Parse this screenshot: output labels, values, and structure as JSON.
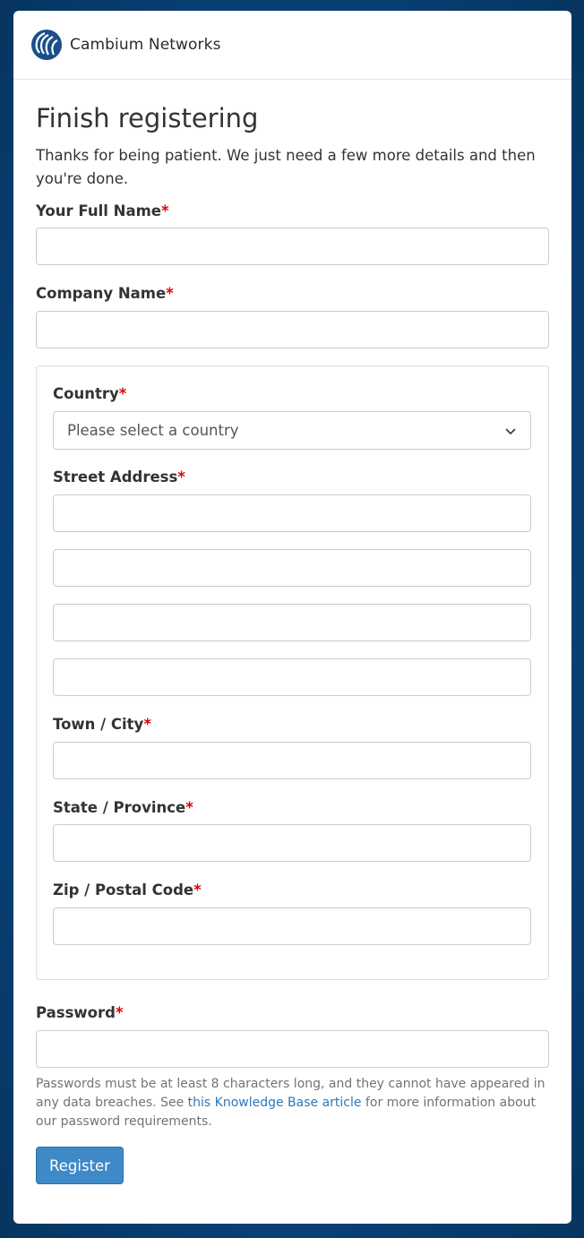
{
  "brand": {
    "name": "Cambium Networks",
    "color": "#1b4f8a"
  },
  "page": {
    "title": "Finish registering",
    "intro": "Thanks for being patient. We just need a few more details and then you're done."
  },
  "form": {
    "required_marker": "*",
    "full_name": {
      "label": "Your Full Name",
      "value": ""
    },
    "company_name": {
      "label": "Company Name",
      "value": ""
    },
    "country": {
      "label": "Country",
      "selected": "Please select a country"
    },
    "street_address": {
      "label": "Street Address",
      "lines": [
        "",
        "",
        "",
        ""
      ]
    },
    "town_city": {
      "label": "Town / City",
      "value": ""
    },
    "state_province": {
      "label": "State / Province",
      "value": ""
    },
    "zip_postal": {
      "label": "Zip / Postal Code",
      "value": ""
    },
    "password": {
      "label": "Password",
      "value": "",
      "help_before": "Passwords must be at least 8 characters long, and they cannot have appeared in any data breaches. See ",
      "help_link": "this Knowledge Base article",
      "help_after": " for more information about our password requirements."
    },
    "submit_label": "Register"
  },
  "colors": {
    "background": "#0a4c8a",
    "required": "#e00000",
    "link": "#2f77b8",
    "button": "#3f89c9"
  },
  "icons": {
    "logo": "cambium-logo-icon",
    "select_arrow": "chevron-down-icon"
  }
}
